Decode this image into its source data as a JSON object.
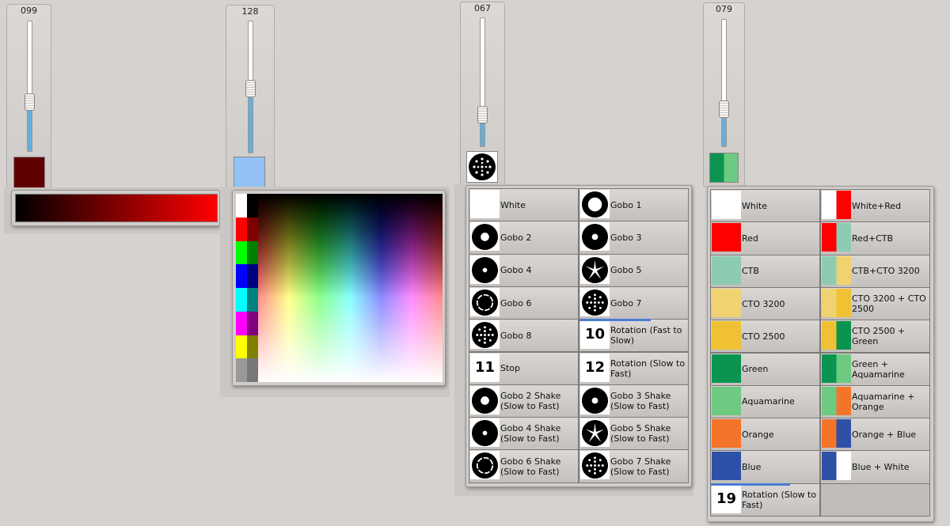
{
  "channels": [
    {
      "value_label": "099",
      "level": 0.39,
      "swatch_color": "#600000"
    },
    {
      "value_label": "128",
      "level": 0.5,
      "swatch_color": "#94c2f6"
    },
    {
      "value_label": "067",
      "level": 0.26,
      "swatch_color": "#ffffff"
    },
    {
      "value_label": "079",
      "level": 0.31,
      "swatch_color": "#0c9450"
    }
  ],
  "gobo_menu": {
    "left": [
      {
        "label": "White",
        "icon": "white"
      },
      {
        "label": "Gobo 2",
        "icon": "gobo-dot-large"
      },
      {
        "label": "Gobo 4",
        "icon": "gobo-dot-small"
      },
      {
        "label": "Gobo 6",
        "icon": "gobo-ring"
      },
      {
        "label": "Gobo 8",
        "icon": "gobo-cluster"
      },
      {
        "label": "Stop",
        "icon": "number",
        "number": "11"
      },
      {
        "label": "Gobo 2 Shake (Slow to Fast)",
        "icon": "gobo-dot-large"
      },
      {
        "label": "Gobo 4 Shake (Slow to Fast)",
        "icon": "gobo-dot-small"
      },
      {
        "label": "Gobo 6 Shake (Slow to Fast)",
        "icon": "gobo-ring"
      }
    ],
    "right": [
      {
        "label": "Gobo 1",
        "icon": "gobo-open"
      },
      {
        "label": "Gobo 3",
        "icon": "gobo-dot-medium"
      },
      {
        "label": "Gobo 5",
        "icon": "gobo-star"
      },
      {
        "label": "Gobo 7",
        "icon": "gobo-dots"
      },
      {
        "label": "Rotation (Fast to Slow)",
        "icon": "number",
        "number": "10",
        "bar": true
      },
      {
        "label": "Rotation (Slow to Fast)",
        "icon": "number",
        "number": "12"
      },
      {
        "label": "Gobo 3 Shake (Slow to Fast)",
        "icon": "gobo-dot-medium"
      },
      {
        "label": "Gobo 5 Shake (Slow to Fast)",
        "icon": "gobo-star"
      },
      {
        "label": "Gobo 7 Shake (Slow to Fast)",
        "icon": "gobo-dots"
      }
    ]
  },
  "color_menu": {
    "left": [
      {
        "label": "White",
        "colors": [
          "#ffffff"
        ]
      },
      {
        "label": "Red",
        "colors": [
          "#ff0000"
        ]
      },
      {
        "label": "CTB",
        "colors": [
          "#8ecbb3"
        ]
      },
      {
        "label": "CTO 3200",
        "colors": [
          "#f0d270"
        ]
      },
      {
        "label": "CTO 2500",
        "colors": [
          "#f0c135"
        ]
      },
      {
        "label": "Green",
        "colors": [
          "#0a9450"
        ]
      },
      {
        "label": "Aquamarine",
        "colors": [
          "#6dca80"
        ]
      },
      {
        "label": "Orange",
        "colors": [
          "#f4742a"
        ]
      },
      {
        "label": "Blue",
        "colors": [
          "#2e50a6"
        ]
      },
      {
        "label": "Rotation (Slow to Fast)",
        "number": "19",
        "bar": true
      }
    ],
    "right": [
      {
        "label": "White+Red",
        "colors": [
          "#ffffff",
          "#ff0000"
        ]
      },
      {
        "label": "Red+CTB",
        "colors": [
          "#ff0000",
          "#8ecbb3"
        ]
      },
      {
        "label": "CTB+CTO 3200",
        "colors": [
          "#8ecbb3",
          "#f0d270"
        ]
      },
      {
        "label": "CTO 3200 + CTO 2500",
        "colors": [
          "#f0d270",
          "#f0c135"
        ]
      },
      {
        "label": "CTO 2500 + Green",
        "colors": [
          "#f0c135",
          "#0a9450"
        ]
      },
      {
        "label": "Green + Aquamarine",
        "colors": [
          "#0a9450",
          "#6dca80"
        ]
      },
      {
        "label": "Aquamarine + Orange",
        "colors": [
          "#6dca80",
          "#f4742a"
        ]
      },
      {
        "label": "Orange + Blue",
        "colors": [
          "#f4742a",
          "#2e50a6"
        ]
      },
      {
        "label": "Blue + White",
        "colors": [
          "#2e50a6",
          "#ffffff"
        ]
      },
      {
        "label": "",
        "empty": true
      }
    ]
  },
  "color_picker": {
    "column_colors": [
      "#ffffff",
      "#ff0000",
      "#00ff00",
      "#0000ff",
      "#00ffff",
      "#ff00ff",
      "#ffff00",
      "#999999"
    ],
    "shade_colors": [
      "#000000",
      "#800000",
      "#008000",
      "#000080",
      "#008080",
      "#800080",
      "#808000",
      "#777777"
    ]
  },
  "gradient_bar": {
    "from": "#000000",
    "to": "#ff0000"
  }
}
